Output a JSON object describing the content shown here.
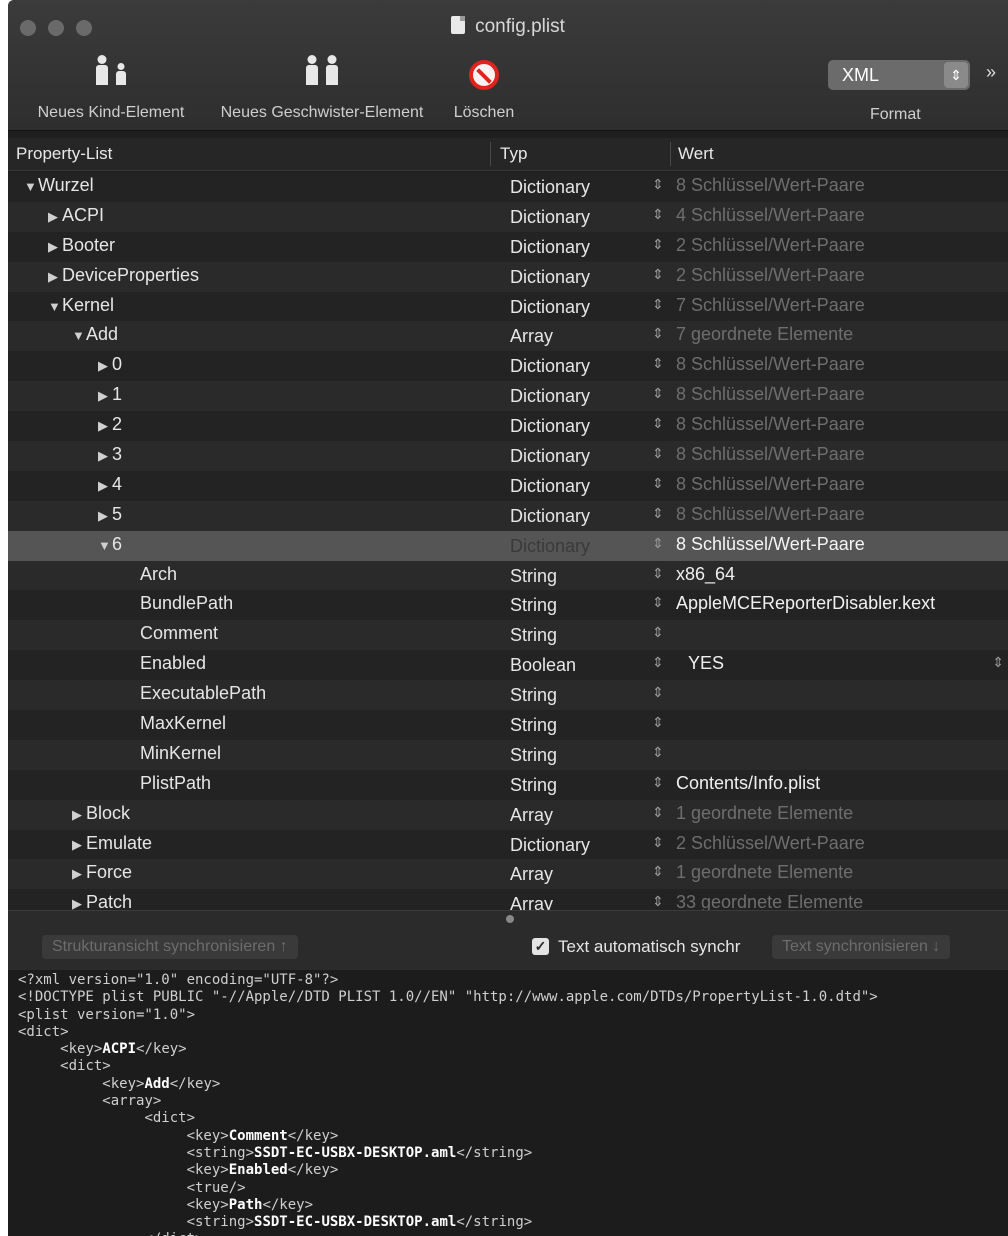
{
  "window": {
    "title": "config.plist"
  },
  "toolbar": {
    "new_child_label": "Neues Kind-Element",
    "new_sibling_label": "Neues Geschwister-Element",
    "delete_label": "Löschen",
    "format_value": "XML",
    "format_label": "Format",
    "overflow": "»"
  },
  "columns": {
    "key": "Property-List",
    "type": "Typ",
    "value": "Wert"
  },
  "rows": [
    {
      "key": "Wurzel",
      "indent": 0,
      "tri": "▼",
      "type": "Dictionary",
      "value": "8 Schlüssel/Wert-Paare",
      "muted": true
    },
    {
      "key": "ACPI",
      "indent": 1,
      "tri": "▶",
      "type": "Dictionary",
      "value": "4 Schlüssel/Wert-Paare",
      "muted": true
    },
    {
      "key": "Booter",
      "indent": 1,
      "tri": "▶",
      "type": "Dictionary",
      "value": "2 Schlüssel/Wert-Paare",
      "muted": true
    },
    {
      "key": "DeviceProperties",
      "indent": 1,
      "tri": "▶",
      "type": "Dictionary",
      "value": "2 Schlüssel/Wert-Paare",
      "muted": true
    },
    {
      "key": "Kernel",
      "indent": 1,
      "tri": "▼",
      "type": "Dictionary",
      "value": "7 Schlüssel/Wert-Paare",
      "muted": true
    },
    {
      "key": "Add",
      "indent": 2,
      "tri": "▼",
      "type": "Array",
      "value": "7 geordnete Elemente",
      "muted": true
    },
    {
      "key": "0",
      "indent": 3,
      "tri": "▶",
      "type": "Dictionary",
      "value": "8 Schlüssel/Wert-Paare",
      "muted": true
    },
    {
      "key": "1",
      "indent": 3,
      "tri": "▶",
      "type": "Dictionary",
      "value": "8 Schlüssel/Wert-Paare",
      "muted": true
    },
    {
      "key": "2",
      "indent": 3,
      "tri": "▶",
      "type": "Dictionary",
      "value": "8 Schlüssel/Wert-Paare",
      "muted": true
    },
    {
      "key": "3",
      "indent": 3,
      "tri": "▶",
      "type": "Dictionary",
      "value": "8 Schlüssel/Wert-Paare",
      "muted": true
    },
    {
      "key": "4",
      "indent": 3,
      "tri": "▶",
      "type": "Dictionary",
      "value": "8 Schlüssel/Wert-Paare",
      "muted": true
    },
    {
      "key": "5",
      "indent": 3,
      "tri": "▶",
      "type": "Dictionary",
      "value": "8 Schlüssel/Wert-Paare",
      "muted": true
    },
    {
      "key": "6",
      "indent": 3,
      "tri": "▼",
      "type": "Dictionary",
      "value": "8 Schlüssel/Wert-Paare",
      "muted": false,
      "selected": true
    },
    {
      "key": "Arch",
      "indent": 4,
      "tri": "",
      "type": "String",
      "value": "x86_64",
      "muted": false
    },
    {
      "key": "BundlePath",
      "indent": 4,
      "tri": "",
      "type": "String",
      "value": "AppleMCEReporterDisabler.kext",
      "muted": false
    },
    {
      "key": "Comment",
      "indent": 4,
      "tri": "",
      "type": "String",
      "value": "",
      "muted": false
    },
    {
      "key": "Enabled",
      "indent": 4,
      "tri": "",
      "type": "Boolean",
      "value": "YES",
      "muted": false,
      "bool": true
    },
    {
      "key": "ExecutablePath",
      "indent": 4,
      "tri": "",
      "type": "String",
      "value": "",
      "muted": false
    },
    {
      "key": "MaxKernel",
      "indent": 4,
      "tri": "",
      "type": "String",
      "value": "",
      "muted": false
    },
    {
      "key": "MinKernel",
      "indent": 4,
      "tri": "",
      "type": "String",
      "value": "",
      "muted": false
    },
    {
      "key": "PlistPath",
      "indent": 4,
      "tri": "",
      "type": "String",
      "value": "Contents/Info.plist",
      "muted": false
    },
    {
      "key": "Block",
      "indent": 2,
      "tri": "▶",
      "type": "Array",
      "value": "1 geordnete Elemente",
      "muted": true
    },
    {
      "key": "Emulate",
      "indent": 2,
      "tri": "▶",
      "type": "Dictionary",
      "value": "2 Schlüssel/Wert-Paare",
      "muted": true
    },
    {
      "key": "Force",
      "indent": 2,
      "tri": "▶",
      "type": "Array",
      "value": "1 geordnete Elemente",
      "muted": true
    },
    {
      "key": "Patch",
      "indent": 2,
      "tri": "▶",
      "type": "Array",
      "value": "33 geordnete Elemente",
      "muted": true
    }
  ],
  "sync": {
    "structure_button": "Strukturansicht synchronisieren ↑",
    "auto_sync_label": "Text automatisch synchr",
    "auto_sync_checked": true,
    "text_button": "Text synchronisieren ↓"
  },
  "xml_lines": [
    {
      "indent": 0,
      "parts": [
        [
          "n",
          "<?xml version=\"1.0\" encoding=\"UTF-8\"?>"
        ]
      ]
    },
    {
      "indent": 0,
      "parts": [
        [
          "n",
          "<!DOCTYPE plist PUBLIC \"-//Apple//DTD PLIST 1.0//EN\" \"http://www.apple.com/DTDs/PropertyList-1.0.dtd\">"
        ]
      ]
    },
    {
      "indent": 0,
      "parts": [
        [
          "n",
          "<plist version=\"1.0\">"
        ]
      ]
    },
    {
      "indent": 0,
      "parts": [
        [
          "n",
          "<dict>"
        ]
      ]
    },
    {
      "indent": 1,
      "parts": [
        [
          "n",
          "<key>"
        ],
        [
          "b",
          "ACPI"
        ],
        [
          "n",
          "</key>"
        ]
      ]
    },
    {
      "indent": 1,
      "parts": [
        [
          "n",
          "<dict>"
        ]
      ]
    },
    {
      "indent": 2,
      "parts": [
        [
          "n",
          "<key>"
        ],
        [
          "b",
          "Add"
        ],
        [
          "n",
          "</key>"
        ]
      ]
    },
    {
      "indent": 2,
      "parts": [
        [
          "n",
          "<array>"
        ]
      ]
    },
    {
      "indent": 3,
      "parts": [
        [
          "n",
          "<dict>"
        ]
      ]
    },
    {
      "indent": 4,
      "parts": [
        [
          "n",
          "<key>"
        ],
        [
          "b",
          "Comment"
        ],
        [
          "n",
          "</key>"
        ]
      ]
    },
    {
      "indent": 4,
      "parts": [
        [
          "n",
          "<string>"
        ],
        [
          "b",
          "SSDT-EC-USBX-DESKTOP.aml"
        ],
        [
          "n",
          "</string>"
        ]
      ]
    },
    {
      "indent": 4,
      "parts": [
        [
          "n",
          "<key>"
        ],
        [
          "b",
          "Enabled"
        ],
        [
          "n",
          "</key>"
        ]
      ]
    },
    {
      "indent": 4,
      "parts": [
        [
          "n",
          "<true/>"
        ]
      ]
    },
    {
      "indent": 4,
      "parts": [
        [
          "n",
          "<key>"
        ],
        [
          "b",
          "Path"
        ],
        [
          "n",
          "</key>"
        ]
      ]
    },
    {
      "indent": 4,
      "parts": [
        [
          "n",
          "<string>"
        ],
        [
          "b",
          "SSDT-EC-USBX-DESKTOP.aml"
        ],
        [
          "n",
          "</string>"
        ]
      ]
    },
    {
      "indent": 3,
      "parts": [
        [
          "n",
          "</dict>"
        ]
      ]
    }
  ]
}
